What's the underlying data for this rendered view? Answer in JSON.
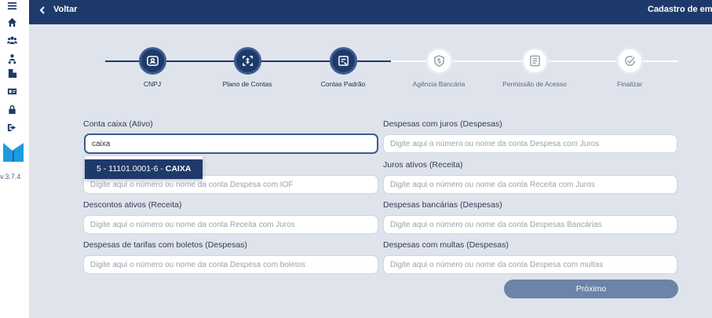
{
  "sidebar": {
    "items": [
      {
        "icon": "menu-icon"
      },
      {
        "icon": "home-icon"
      },
      {
        "icon": "users-group-icon"
      },
      {
        "icon": "user-tree-icon"
      },
      {
        "icon": "building-user-icon"
      },
      {
        "icon": "id-card-icon"
      },
      {
        "icon": "lock-icon"
      },
      {
        "icon": "logout-icon"
      }
    ],
    "version": "v.3.7.4"
  },
  "header": {
    "back_label": "Voltar",
    "title": "Cadastro de empre"
  },
  "steps": [
    {
      "label": "CNPJ",
      "state": "done",
      "icon": "id-badge-icon"
    },
    {
      "label": "Plano de Contas",
      "state": "done",
      "icon": "plan-icon"
    },
    {
      "label": "Contas Padrão",
      "state": "done",
      "icon": "accounts-icon"
    },
    {
      "label": "Agência Bancária",
      "state": "todo",
      "icon": "bank-shield-icon"
    },
    {
      "label": "Permissão de Acesso",
      "state": "todo",
      "icon": "access-list-icon"
    },
    {
      "label": "Finalizar",
      "state": "todo",
      "icon": "check-circle-icon"
    }
  ],
  "form": {
    "conta_caixa": {
      "label": "Conta caixa (Ativo)",
      "value": "caixa"
    },
    "despesas_juros": {
      "label": "Despesas com juros (Despesas)",
      "placeholder": "Digite aqui o número ou nome da conta Despesa com Juros"
    },
    "despesa_iof": {
      "placeholder": "Digite aqui o número ou nome da conta Despesa com IOF"
    },
    "juros_ativos": {
      "label": "Juros ativos (Receita)",
      "placeholder": "Digite aqui o número ou nome da conta Receita com Juros"
    },
    "descontos_ativos": {
      "label": "Descontos ativos (Receita)",
      "placeholder": "Digite aqui o número ou nome da conta Receita com Juros"
    },
    "despesas_bancarias": {
      "label": "Despesas bancárias (Despesas)",
      "placeholder": "Digite aqui o número ou nome da conta Despesas Bancárias"
    },
    "despesas_tarifas": {
      "label": "Despesas de tarifas com boletos (Despesas)",
      "placeholder": "Digite aqui o número ou nome da conta Despesa com boletos"
    },
    "despesas_multas": {
      "label": "Despesas com multas (Despesas)",
      "placeholder": "Digite aqui o número ou nome da conta Despesa com multas"
    }
  },
  "autocomplete": {
    "option_prefix": "5 - 11101.0001-6 - ",
    "option_name": "CAIXA"
  },
  "next_label": "Próximo",
  "colors": {
    "primary": "#1e3a6b",
    "background": "#dfe3ec",
    "button": "#6b84a8"
  }
}
